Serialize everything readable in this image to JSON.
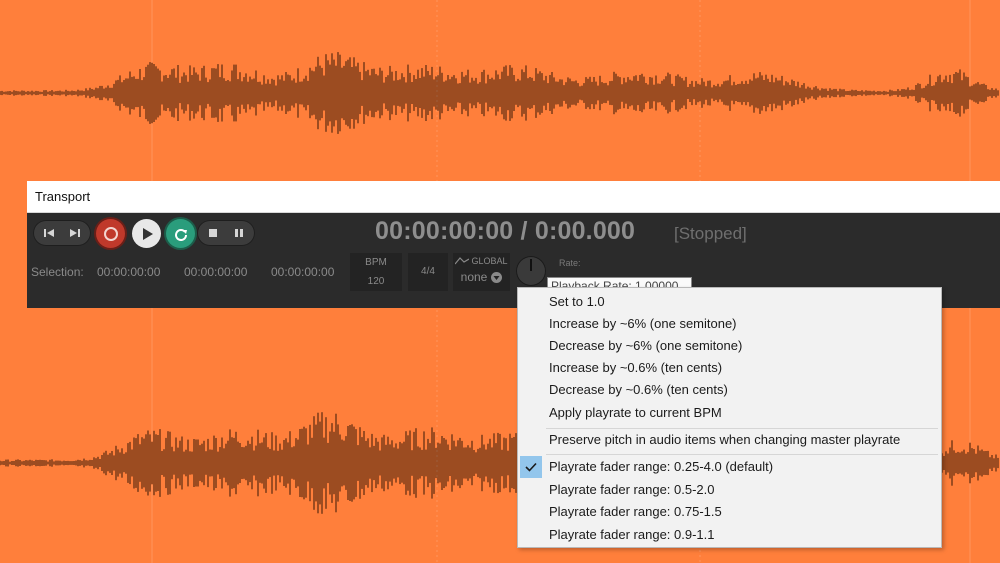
{
  "window": {
    "title": "Transport"
  },
  "transport": {
    "time_display": "00:00:00:00 / 0:00.000",
    "status": "[Stopped]",
    "selection_label": "Selection:",
    "selection_start": "00:00:00:00",
    "selection_end": "00:00:00:00",
    "selection_length": "00:00:00:00",
    "bpm_label": "BPM",
    "bpm_value": "120",
    "time_signature": "4/4",
    "global_label": "GLOBAL",
    "global_value": "none",
    "rate_label": "Rate:",
    "rate_tooltip": "Playback Rate: 1.00000",
    "buttons": [
      "go-to-start",
      "go-to-end",
      "record",
      "play",
      "repeat",
      "stop",
      "pause"
    ]
  },
  "menu": {
    "items": [
      {
        "label": "Set to 1.0"
      },
      {
        "label": "Increase by ~6% (one semitone)"
      },
      {
        "label": "Decrease by ~6% (one semitone)"
      },
      {
        "label": "Increase by ~0.6% (ten cents)"
      },
      {
        "label": "Decrease by ~0.6% (ten cents)"
      },
      {
        "label": "Apply playrate to current BPM"
      },
      {
        "label": "Preserve pitch in audio items when changing master playrate"
      },
      {
        "label": "Playrate fader range: 0.25-4.0 (default)",
        "checked": true
      },
      {
        "label": "Playrate fader range: 0.5-2.0"
      },
      {
        "label": "Playrate fader range: 0.75-1.5"
      },
      {
        "label": "Playrate fader range: 0.9-1.1"
      }
    ]
  },
  "colors": {
    "background": "#ff7f3b",
    "waveform": "#5a2a10",
    "transport_bg": "#2b2b2b",
    "record": "#c0392b",
    "repeat": "#2a9d7c",
    "menu_check_highlight": "#93c6ec"
  }
}
